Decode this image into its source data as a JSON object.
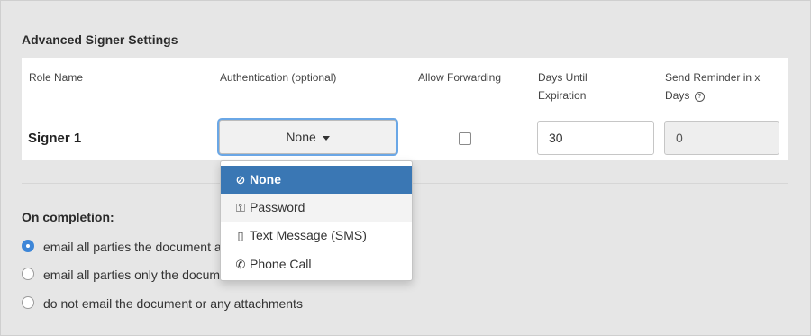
{
  "section_title": "Advanced Signer Settings",
  "table": {
    "headers": {
      "role_name": "Role Name",
      "authentication": "Authentication (optional)",
      "allow_forwarding": "Allow Forwarding",
      "days_until_expiration": [
        "Days Until",
        "Expiration"
      ],
      "send_reminder": [
        "Send Reminder in x",
        "Days"
      ]
    },
    "row": {
      "signer": "Signer 1",
      "authentication_value": "None",
      "allow_forwarding": false,
      "days_until_expiration": "30",
      "send_reminder": "0"
    }
  },
  "auth_dropdown": {
    "options": [
      {
        "label": "None",
        "icon": "⊘",
        "icon_name": "none-icon",
        "selected": true
      },
      {
        "label": "Password",
        "icon": "⚿",
        "icon_name": "key-icon",
        "selected": false
      },
      {
        "label": "Text Message (SMS)",
        "icon": "▯",
        "icon_name": "phone-sms-icon",
        "selected": false
      },
      {
        "label": "Phone Call",
        "icon": "✆",
        "icon_name": "phone-call-icon",
        "selected": false
      }
    ]
  },
  "on_completion": {
    "title": "On completion:",
    "options": [
      {
        "label": "email all parties the document and any attachments",
        "checked": true
      },
      {
        "label": "email all parties only the document",
        "checked": false
      },
      {
        "label": "do not email the document or any attachments",
        "checked": false
      }
    ]
  },
  "colors": {
    "accent": "#3d86d8",
    "selected_option_bg": "#3a77b4",
    "focus_ring": "#6aa7e6"
  }
}
